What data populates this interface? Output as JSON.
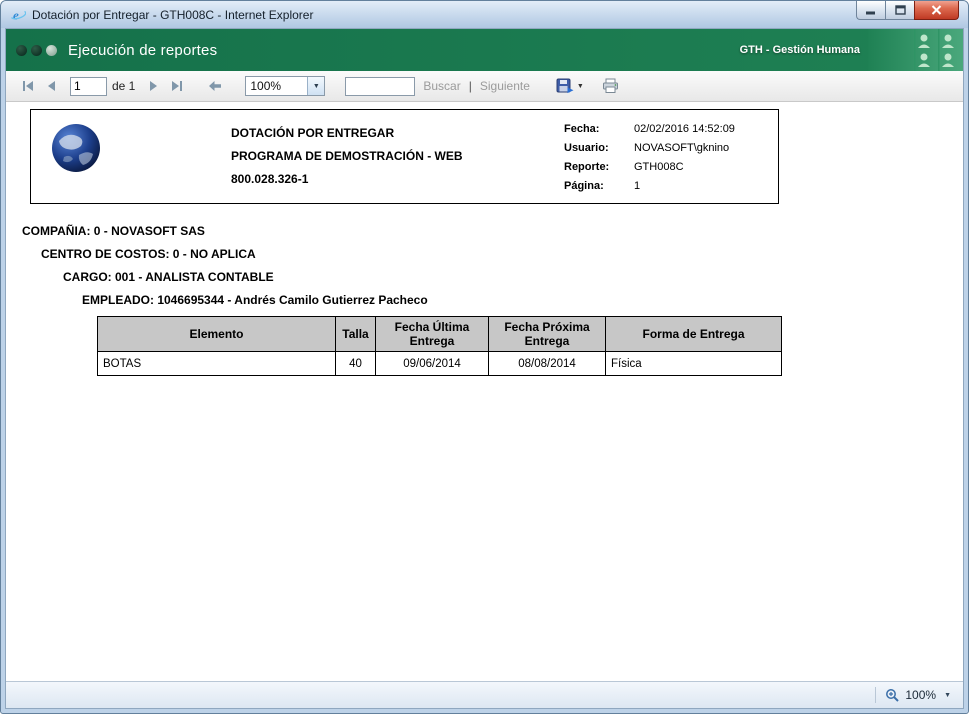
{
  "window": {
    "title": "Dotación por Entregar - GTH008C - Internet Explorer"
  },
  "header": {
    "title": "Ejecución de reportes",
    "brand": "GTH - Gestión Humana"
  },
  "toolbar": {
    "page_value": "1",
    "of_label": "de 1",
    "zoom_value": "100%",
    "search_value": "",
    "find_label": "Buscar",
    "separator": "|",
    "find_next_label": "Siguiente"
  },
  "report": {
    "header": {
      "title": "DOTACIÓN POR ENTREGAR",
      "subtitle": "PROGRAMA DE DEMOSTRACIÓN - WEB",
      "nit": "800.028.326-1",
      "meta": [
        {
          "label": "Fecha:",
          "value": "02/02/2016 14:52:09"
        },
        {
          "label": "Usuario:",
          "value": "NOVASOFT\\gknino"
        },
        {
          "label": "Reporte:",
          "value": "GTH008C"
        },
        {
          "label": "Página:",
          "value": "1"
        }
      ]
    },
    "groups": [
      "COMPAÑIA: 0 - NOVASOFT SAS",
      "CENTRO DE COSTOS: 0 - NO APLICA",
      "CARGO: 001 - ANALISTA CONTABLE",
      "EMPLEADO: 1046695344 - Andrés Camilo Gutierrez Pacheco"
    ],
    "table": {
      "headers": [
        "Elemento",
        "Talla",
        "Fecha Última Entrega",
        "Fecha Próxima Entrega",
        "Forma de Entrega"
      ],
      "rows": [
        [
          "BOTAS",
          "40",
          "09/06/2014",
          "08/08/2014",
          "Física"
        ]
      ]
    }
  },
  "statusbar": {
    "zoom_level": "100%"
  },
  "icons": {
    "caret": "▼"
  },
  "colors": {
    "header_green": "#16754c",
    "close_red": "#bf3a24",
    "table_header_gray": "#c7c7c7",
    "titlebar_blue": "#c6d8ec"
  }
}
